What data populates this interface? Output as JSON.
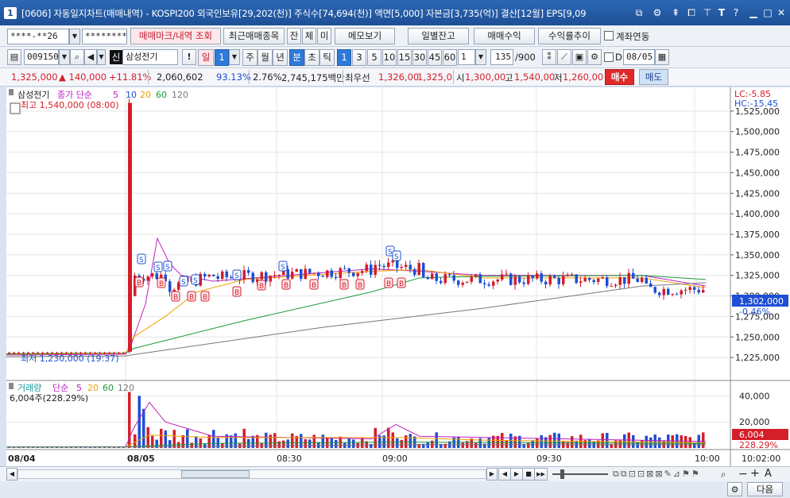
{
  "window": {
    "number": "1",
    "title": "[0606] 자동일지차트(매매내역) - KOSPI200 외국인보유[29,202(천)] 주식수[74,694(천)] 액면[5,000] 자본금[3,735(억)] 결산[12월] EPS[9,09"
  },
  "toolbar1": {
    "account_value": "****-**26",
    "password_value": "********",
    "trade_mark_label": "매매마크/내역 조회",
    "recent_trades_label": "최근매매종목",
    "jan_label": "잔",
    "che_label": "체",
    "mi_label": "미",
    "memo_label": "메모보기",
    "daily_balance_label": "일별잔고",
    "trade_profit_label": "매매수익",
    "return_trend_label": "수익률추이",
    "account_link_label": "계좌연동"
  },
  "toolbar2": {
    "code_value": "009150",
    "sin_badge": "신",
    "stock_name": "삼성전기",
    "excl": "!",
    "day_label": "일",
    "interval_value": "1",
    "periods": [
      "주",
      "월",
      "년",
      "분",
      "초",
      "틱"
    ],
    "minutes": [
      "1",
      "3",
      "5",
      "10",
      "15",
      "30",
      "45",
      "60"
    ],
    "count_value": "1",
    "bars_value": "135",
    "bars_total": "/900",
    "d_label": "D",
    "date_value": "08/05"
  },
  "quote": {
    "price": "1,325,000",
    "change": "▲ 140,000",
    "change_pct": "+11.81%",
    "volume": "2,060,602",
    "vol_ratio": "93.13%",
    "turnover_pct": "2.76%",
    "amount": "2,745,175백만",
    "best_bid_label": "최우선",
    "best_ask": "1,326,00",
    "best_bid": "1,325,0",
    "open_label": "시",
    "open": "1,300,00",
    "high_label": "고",
    "high": "1,540,00",
    "low_label": "저",
    "low": "1,260,00",
    "buy_label": "매수",
    "sell_label": "매도"
  },
  "colors": {
    "up": "#d41e2a",
    "down": "#1e4fd4",
    "ma5": "#c020c0",
    "ma20": "#f0a000",
    "ma60": "#1a9a3a",
    "ma120": "#777777"
  },
  "chart_data": [
    {
      "type": "candlestick",
      "title": "",
      "legend": {
        "stock": "삼성전기",
        "kind": "종가 단순",
        "periods": [
          "5",
          "10",
          "20",
          "60",
          "120"
        ]
      },
      "lc_label": "LC:-5.85",
      "hc_label": "HC:-15.45",
      "high_annotation": "최고 1,540,000 (08:00)",
      "low_annotation": "최저 1,230,000 (19:37)",
      "current_price_label": "1,302,000",
      "current_pct_label": "-0.46%",
      "ylim": [
        1200000,
        1550000
      ],
      "y_ticks": [
        1225000,
        1250000,
        1275000,
        1300000,
        1325000,
        1350000,
        1375000,
        1400000,
        1425000,
        1450000,
        1475000,
        1500000,
        1525000
      ],
      "y_tick_labels": [
        "1,225,000",
        "1,250,000",
        "1,275,000",
        "1,300,000",
        "1,325,000",
        "1,350,000",
        "1,375,000",
        "1,400,000",
        "1,425,000",
        "1,450,000",
        "1,475,000",
        "1,500,000",
        "1,525,000"
      ],
      "markers": {
        "buy": "B",
        "sell": "S"
      },
      "series_notes": "single price series"
    },
    {
      "type": "bar",
      "title": "",
      "legend": {
        "name": "거래량",
        "kind": "단순",
        "periods": [
          "5",
          "20",
          "60",
          "120"
        ]
      },
      "summary": "6,004주(228.29%)",
      "current_label": "6,004",
      "current_pct": "228.29%",
      "ylim": [
        0,
        50000
      ],
      "y_ticks": [
        20000,
        40000
      ],
      "y_tick_labels": [
        "20,000",
        "40,000"
      ]
    }
  ],
  "time_axis": {
    "labels": [
      "08/04",
      "08/05",
      "08:30",
      "09:00",
      "09:30",
      "10:00"
    ],
    "right_label": "10:02:00"
  },
  "bottombar": {
    "prev_label": "◀",
    "play_label": "▶",
    "stop_label": "■",
    "next_label": "▶▶",
    "zoom_out": "−",
    "zoom_in": "+",
    "font_label": "A"
  },
  "statusbar": {
    "next_button": "다음"
  }
}
